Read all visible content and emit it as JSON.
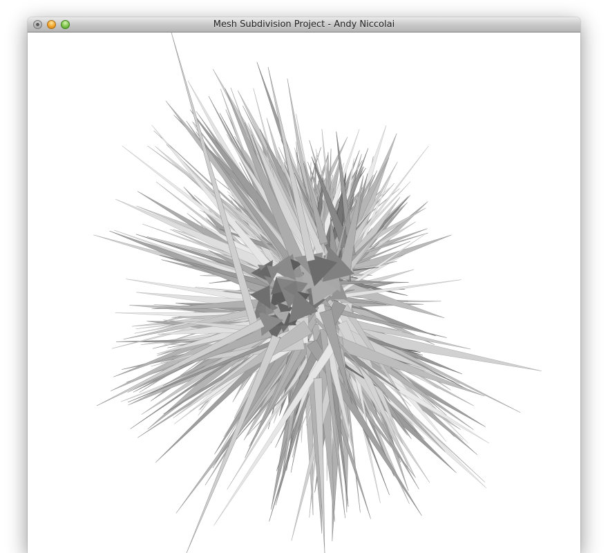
{
  "window": {
    "title": "Mesh Subdivision Project - Andy Niccolai"
  },
  "titlebar": {
    "buttons": [
      {
        "name": "close",
        "color": "#9a9a9a"
      },
      {
        "name": "minimize",
        "color": "#f0a52a"
      },
      {
        "name": "zoom",
        "color": "#7cc44a"
      }
    ]
  },
  "viewport": {
    "background": "#ffffff",
    "content": "rendered spiky gray 3D mesh",
    "shade_light": "#e4e4e4",
    "shade_dark": "#5a5a5a"
  }
}
